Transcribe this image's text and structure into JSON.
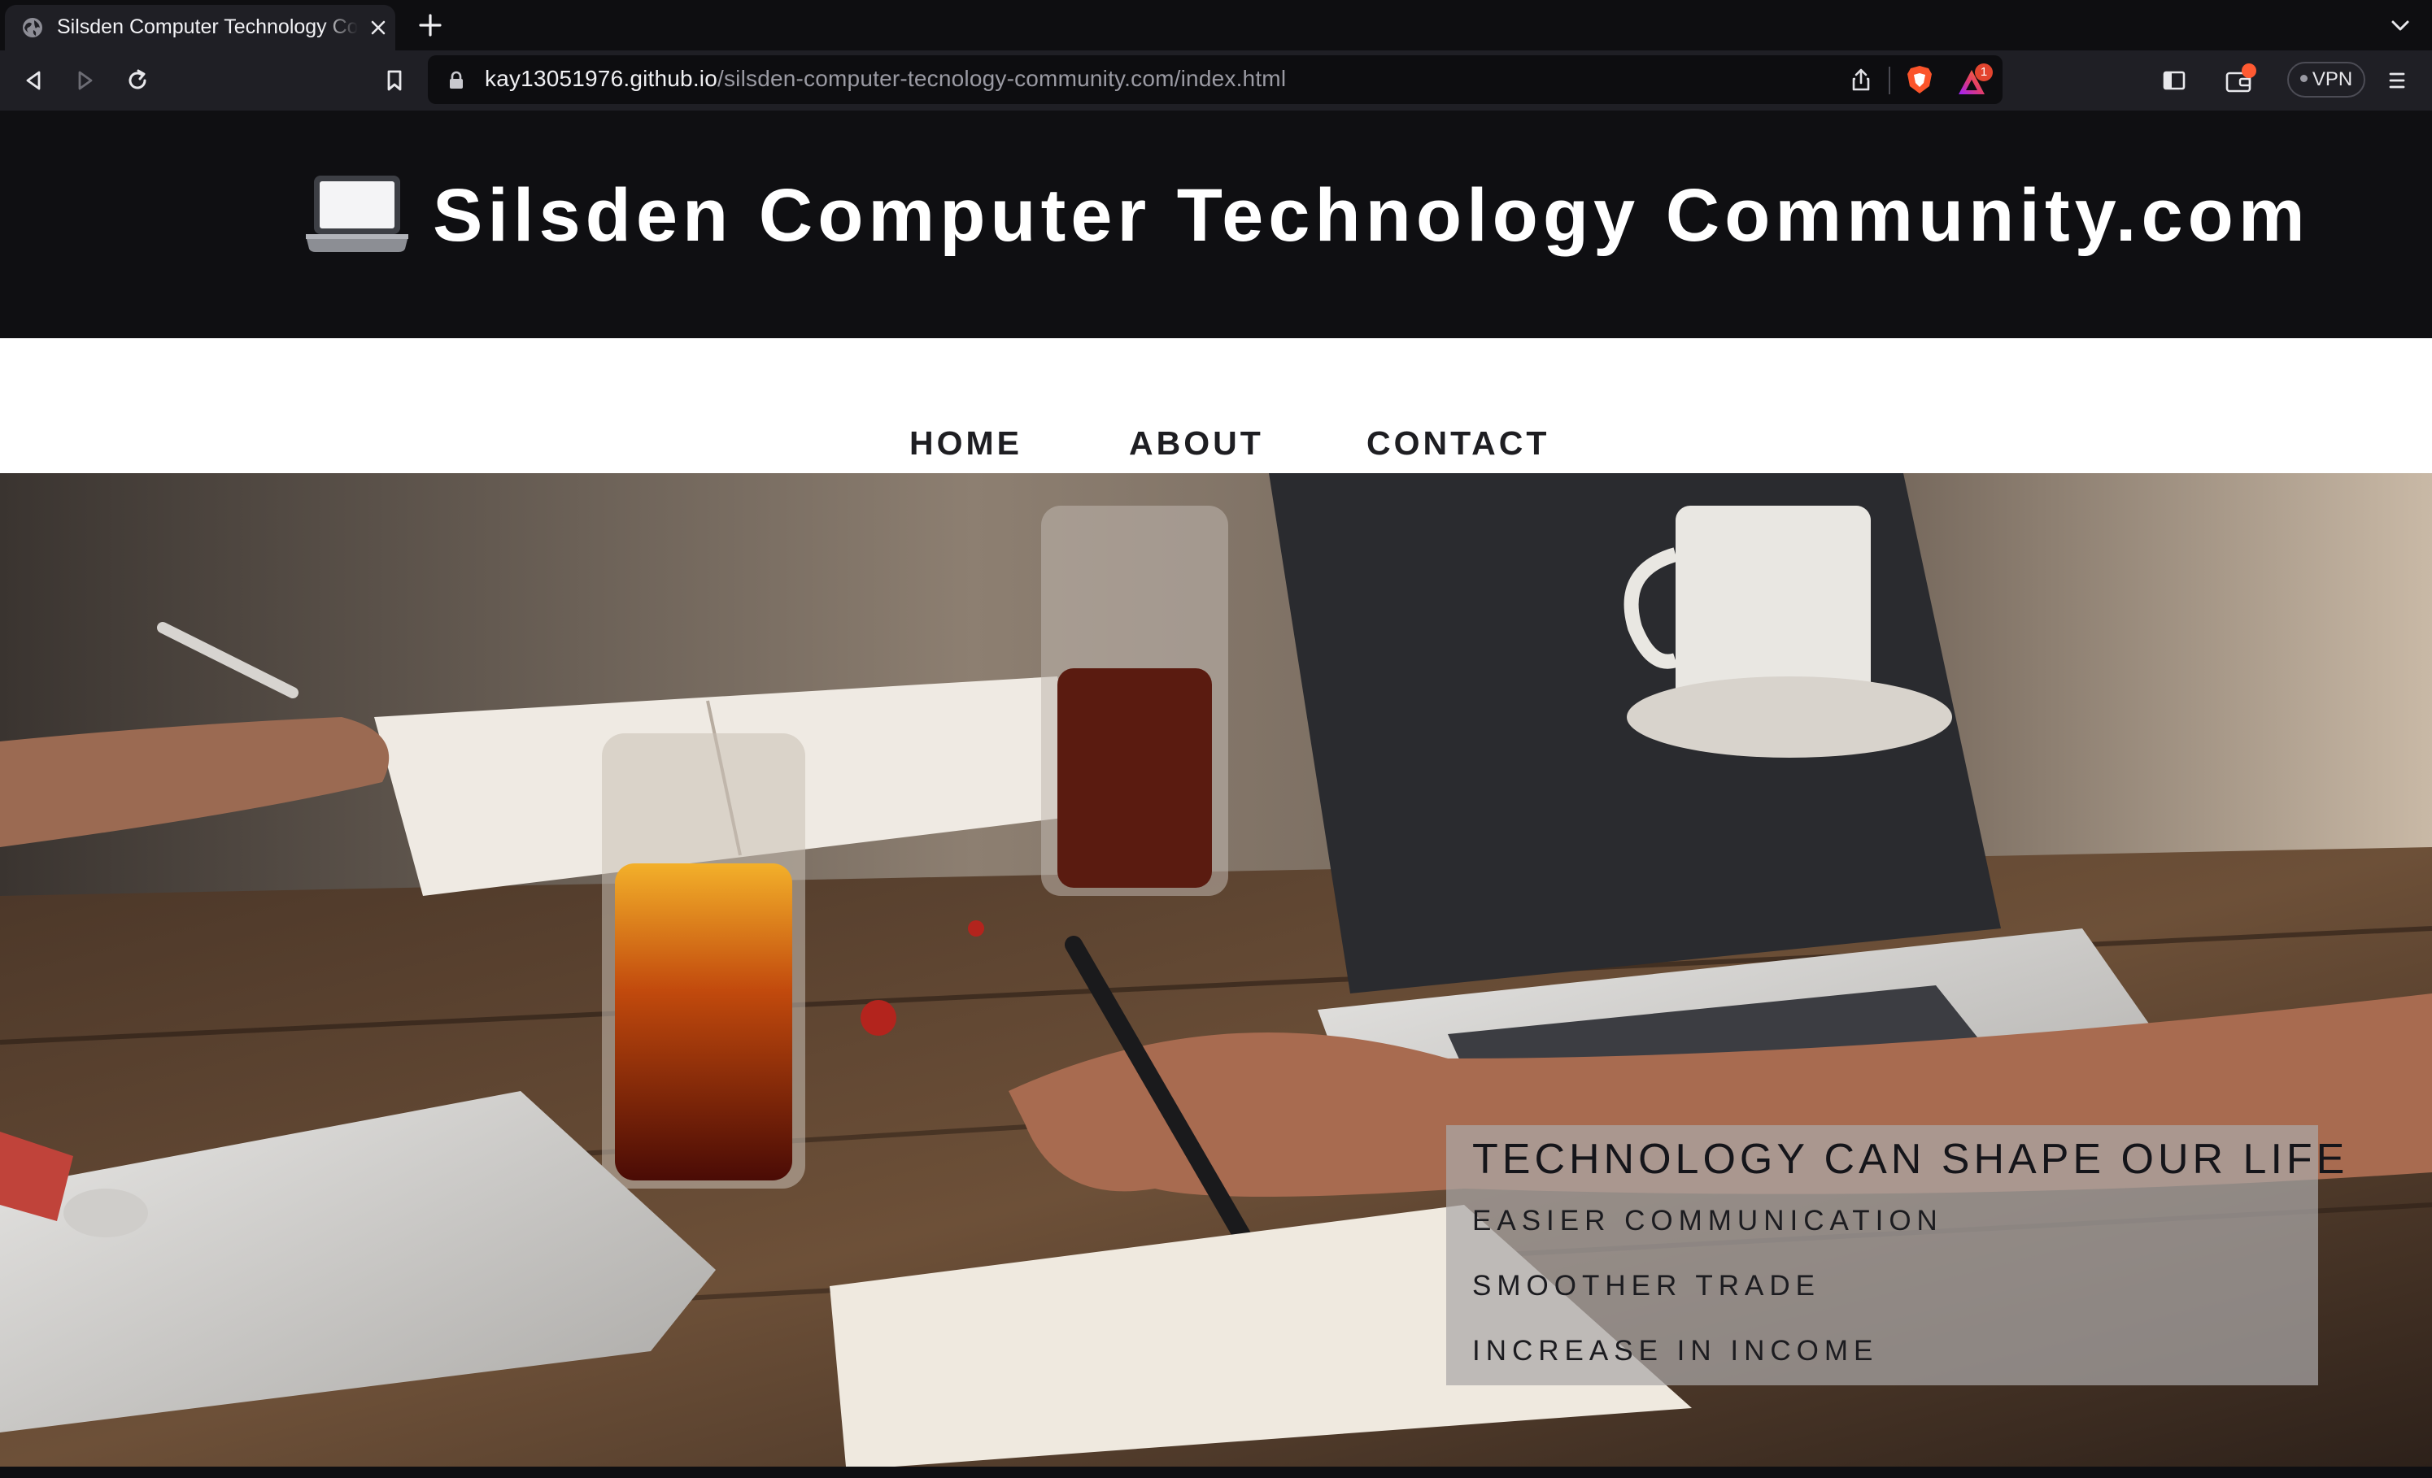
{
  "browser": {
    "tab_title": "Silsden Computer Technology Community.com",
    "url_host": "kay13051976.github.io",
    "url_path": "/silsden-computer-tecnology-community.com/index.html",
    "rewards_badge": "1",
    "vpn_label": "VPN",
    "icons": [
      "globe-icon",
      "close-icon",
      "plus-icon",
      "chevron-down-icon",
      "back-icon",
      "forward-icon",
      "reload-icon",
      "bookmark-icon",
      "lock-icon",
      "share-icon",
      "brave-shield-icon",
      "brave-rewards-icon",
      "sidebar-icon",
      "wallet-icon",
      "menu-icon"
    ]
  },
  "header": {
    "logo_icon": "laptop-emoji",
    "title": "Silsden Computer Technology Community.com"
  },
  "nav": {
    "items": [
      {
        "label": "HOME"
      },
      {
        "label": "ABOUT"
      },
      {
        "label": "CONTACT"
      }
    ]
  },
  "hero": {
    "image_subject": "people working at a wooden table with laptops and drinks",
    "overlay": {
      "headline": "TECHNOLOGY CAN SHAPE OUR LIFE",
      "items": [
        "EASIER COMMUNICATION",
        "SMOOTHER TRADE",
        "INCREASE IN INCOME"
      ]
    }
  },
  "colors": {
    "header_bg": "#0f0f12",
    "nav_bg": "#ffffff",
    "nav_text": "#1e1e22",
    "overlay_bg": "#aaa8a8"
  }
}
